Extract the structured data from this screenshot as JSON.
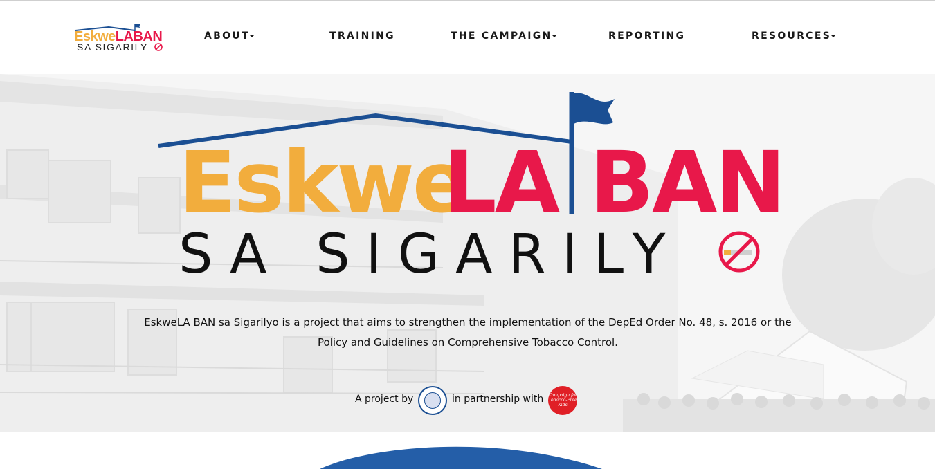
{
  "header": {
    "logo": {
      "line1_a": "Eskwe",
      "line1_b": "LA",
      "line1_c": "BAN",
      "line2": "SA SIGARILY"
    },
    "nav": [
      {
        "label": "ABOUT",
        "dropdown": true
      },
      {
        "label": "TRAINING",
        "dropdown": false
      },
      {
        "label": "THE CAMPAIGN",
        "dropdown": true
      },
      {
        "label": "REPORTING",
        "dropdown": false
      },
      {
        "label": "RESOURCES",
        "dropdown": true
      }
    ]
  },
  "hero": {
    "title_yellow": "Eskwe",
    "title_red_1": "LA",
    "title_red_2": "BAN",
    "subtitle": "SA SIGARILY",
    "description_line1": "EskweLA BAN sa Sigarilyo is a project that aims to strengthen the implementation of the DepEd Order No. 48, s. 2016 or the",
    "description_line2": "Policy and Guidelines on Comprehensive Tobacco Control.",
    "project_by": "A project by",
    "partnership": "in partnership with",
    "partner_logo_text": "Campaign for Tobacco-Free Kids",
    "background_image": "grayscale-school-building-photo"
  },
  "colors": {
    "brand_yellow": "#f2ad3d",
    "brand_red": "#e8184a",
    "brand_blue": "#1b4f93",
    "wave_blue": "#245ea8"
  },
  "icons": [
    "no-smoking-icon",
    "flag-icon",
    "deped-seal-icon",
    "ctfk-logo-icon",
    "caret-down-icon"
  ]
}
